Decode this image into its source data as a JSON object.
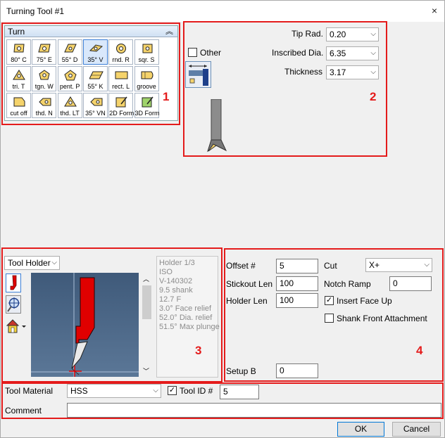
{
  "window": {
    "title": "Turning Tool #1",
    "close_glyph": "×"
  },
  "palette": {
    "header": "Turn",
    "items": [
      {
        "label": "80° C",
        "icon": "insert-80c-icon"
      },
      {
        "label": "75° E",
        "icon": "insert-75e-icon"
      },
      {
        "label": "55° D",
        "icon": "insert-55d-icon"
      },
      {
        "label": "35° V",
        "icon": "insert-35v-icon",
        "selected": true
      },
      {
        "label": "rnd. R",
        "icon": "insert-round-icon"
      },
      {
        "label": "sqr. S",
        "icon": "insert-square-icon"
      },
      {
        "label": "tri. T",
        "icon": "insert-triangle-icon"
      },
      {
        "label": "tgn. W",
        "icon": "insert-trigon-icon"
      },
      {
        "label": "pent. P",
        "icon": "insert-pentagon-icon"
      },
      {
        "label": "55° K",
        "icon": "insert-55k-icon"
      },
      {
        "label": "rect. L",
        "icon": "insert-rect-icon"
      },
      {
        "label": "groove",
        "icon": "insert-groove-icon"
      },
      {
        "label": "cut off",
        "icon": "insert-cutoff-icon"
      },
      {
        "label": "thd. N",
        "icon": "insert-thread-n-icon"
      },
      {
        "label": "thd. LT",
        "icon": "insert-thread-lt-icon"
      },
      {
        "label": "35° VN",
        "icon": "insert-35vn-icon"
      },
      {
        "label": "2D Form",
        "icon": "insert-2dform-icon"
      },
      {
        "label": "3D Form",
        "icon": "insert-3dform-icon"
      }
    ]
  },
  "insert": {
    "other_label": "Other",
    "other_checked": false,
    "tip_rad": {
      "label": "Tip Rad.",
      "value": "0.20"
    },
    "inscribed_dia": {
      "label": "Inscribed Dia.",
      "value": "6.35"
    },
    "thickness": {
      "label": "Thickness",
      "value": "3.17"
    }
  },
  "holder": {
    "type_value": "Tool Holder",
    "info": [
      "Holder 1/3",
      "ISO",
      "V-140302",
      "9.5 shank",
      "12.7 F",
      "3.0° Face relief",
      "52.0° Dia. relief",
      "51.5° Max plunge"
    ]
  },
  "params": {
    "offset": {
      "label": "Offset #",
      "value": "5"
    },
    "stickout": {
      "label": "Stickout Len",
      "value": "100"
    },
    "holder_len": {
      "label": "Holder Len",
      "value": "100"
    },
    "setup_b": {
      "label": "Setup B",
      "value": "0"
    },
    "cut": {
      "label": "Cut",
      "value": "X+"
    },
    "notch_ramp": {
      "label": "Notch Ramp",
      "value": "0"
    },
    "insert_face_up": {
      "label": "Insert Face Up",
      "checked": true
    },
    "shank_front": {
      "label": "Shank Front Attachment",
      "checked": false
    }
  },
  "bottom": {
    "material_label": "Tool Material",
    "material_value": "HSS",
    "tool_id_label": "Tool ID #",
    "tool_id_checked": true,
    "tool_id_value": "5",
    "comment_label": "Comment",
    "comment_value": ""
  },
  "buttons": {
    "ok": "OK",
    "cancel": "Cancel"
  },
  "callouts": [
    "1",
    "2",
    "3",
    "4"
  ],
  "colors": {
    "callout": "#e41b1b",
    "accent": "#0078d7",
    "insert_fill": "#f5d36b",
    "tool_red": "#e00000"
  }
}
